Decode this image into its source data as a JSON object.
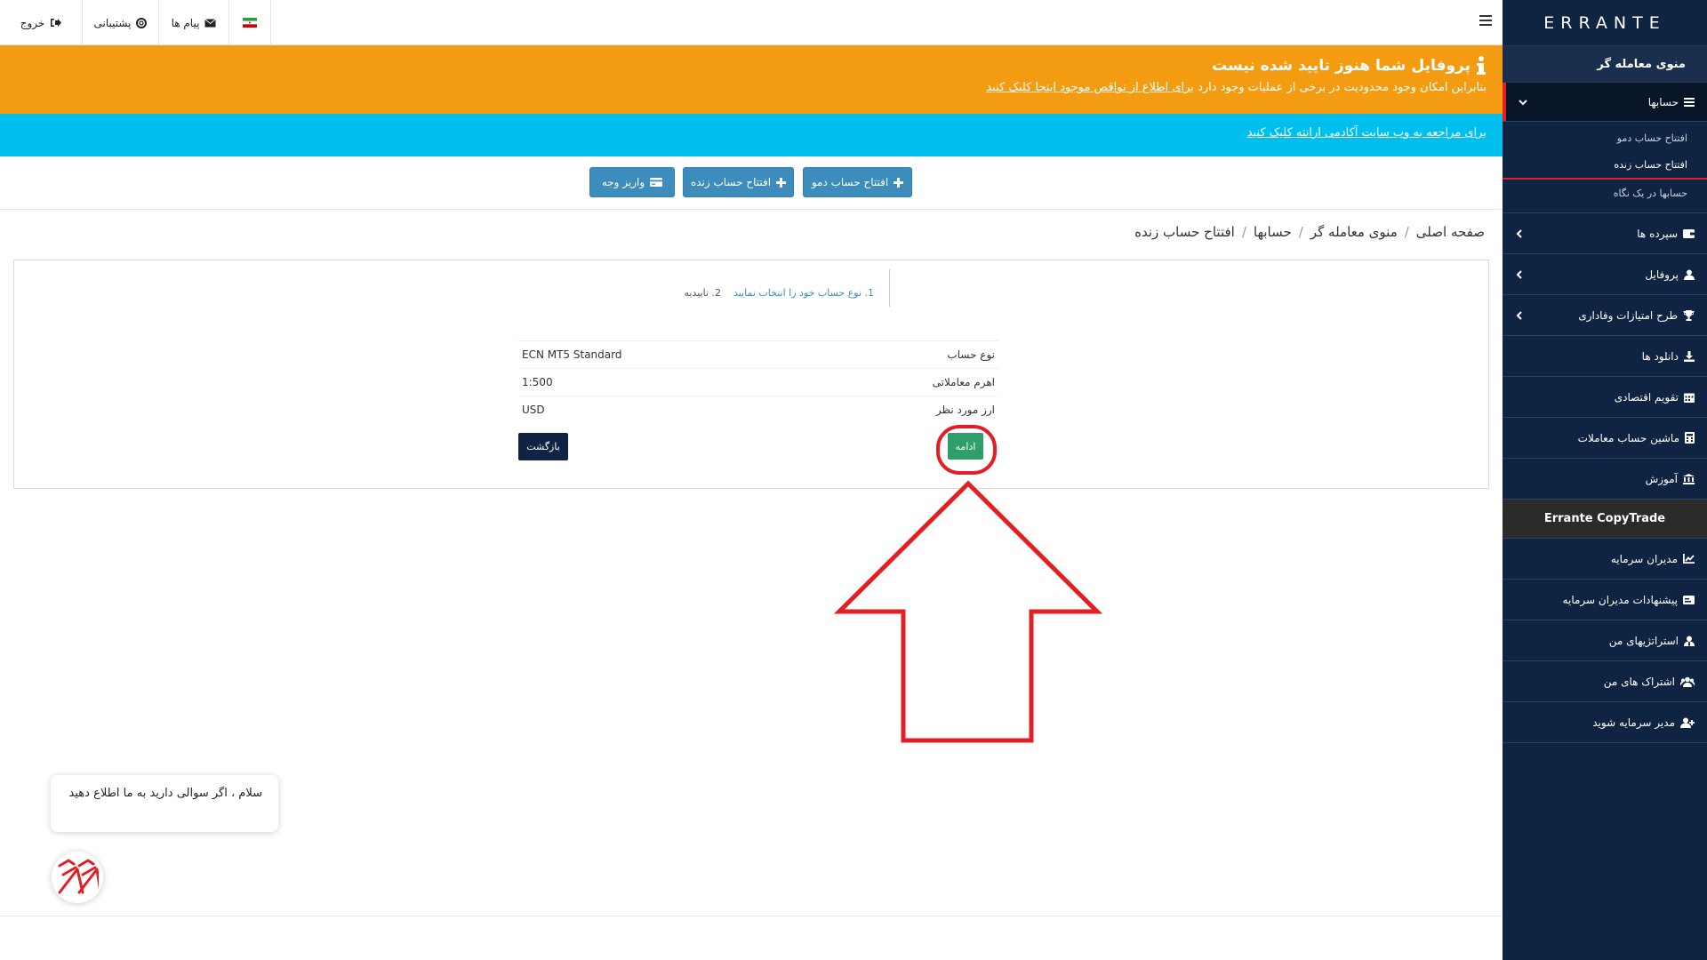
{
  "topbar": {
    "exit_label": "خروج",
    "support_label": "پشتیبانی",
    "messages_label": "پیام ها"
  },
  "alerts": {
    "profile_title": "پروفایل شما هنوز تایید شده نیست",
    "profile_text": "بنابراین امکان وجود محدودیت در برخی از عملیات وجود دارد",
    "profile_link": "برای اطلاع از نواقص موجود اینجا کلیک کنید",
    "academy_link": "برای مراجعه به وب سایت آکادمی ارانته کلیک کنید"
  },
  "actions": {
    "demo_label": "افتتاح حساب دمو",
    "live_label": "افتتاح حساب زنده",
    "deposit_label": "واریز وجه"
  },
  "breadcrumb": [
    "صفحه اصلی",
    "منوی معامله گر",
    "حسابها",
    "افتتاح حساب زنده"
  ],
  "steps": {
    "step1": "1. نوع حساب خود را انتخاب نمایید",
    "step2": "2. تاییدیه"
  },
  "summary": [
    {
      "label": "نوع حساب",
      "value": "ECN MT5 Standard"
    },
    {
      "label": "اهرم معاملاتی",
      "value": "1:500"
    },
    {
      "label": "ارز مورد نظر",
      "value": "USD"
    }
  ],
  "buttons": {
    "continue_label": "ادامه",
    "back_label": "بازگشت"
  },
  "chat": {
    "message": "سلام ، اگر سوالی دارید به ما اطلاع دهید"
  },
  "sidebar": {
    "logo": "ERRANTE",
    "menu_title": "منوی معامله گر",
    "accounts_label": "حسابها",
    "sub_items": [
      "افتتاح حساب دمو",
      "افتتاح حساب زنده",
      "حسابها در یک نگاه"
    ],
    "items": [
      {
        "label": "سپرده ها",
        "icon": "wallet-icon"
      },
      {
        "label": "پروفایل",
        "icon": "user-icon"
      },
      {
        "label": "طرح امتیازات وفاداری",
        "icon": "trophy-icon"
      },
      {
        "label": "دانلود ها",
        "icon": "download-icon"
      },
      {
        "label": "تقویم اقتصادی",
        "icon": "calendar-icon"
      },
      {
        "label": "ماشین حساب معاملات",
        "icon": "calculator-icon"
      },
      {
        "label": "آموزش",
        "icon": "bank-icon"
      }
    ],
    "copy_header": "Errante CopyTrade",
    "copy_items": [
      {
        "label": "مدیران سرمایه",
        "icon": "chart-icon"
      },
      {
        "label": "پیشنهادات مدیران سرمایه",
        "icon": "card-icon"
      },
      {
        "label": "استراتژیهای من",
        "icon": "user-tie-icon"
      },
      {
        "label": "اشتراک های من",
        "icon": "users-icon"
      },
      {
        "label": "مدیر سرمایه شوید",
        "icon": "user-plus-icon"
      }
    ]
  },
  "colors": {
    "sidebar_bg": "#0f2443",
    "alert_orange": "#f39c12",
    "alert_blue": "#00bfef",
    "primary_button": "#3c8dbc",
    "continue_button": "#2e9e6a",
    "highlight_red": "#e31e24"
  }
}
